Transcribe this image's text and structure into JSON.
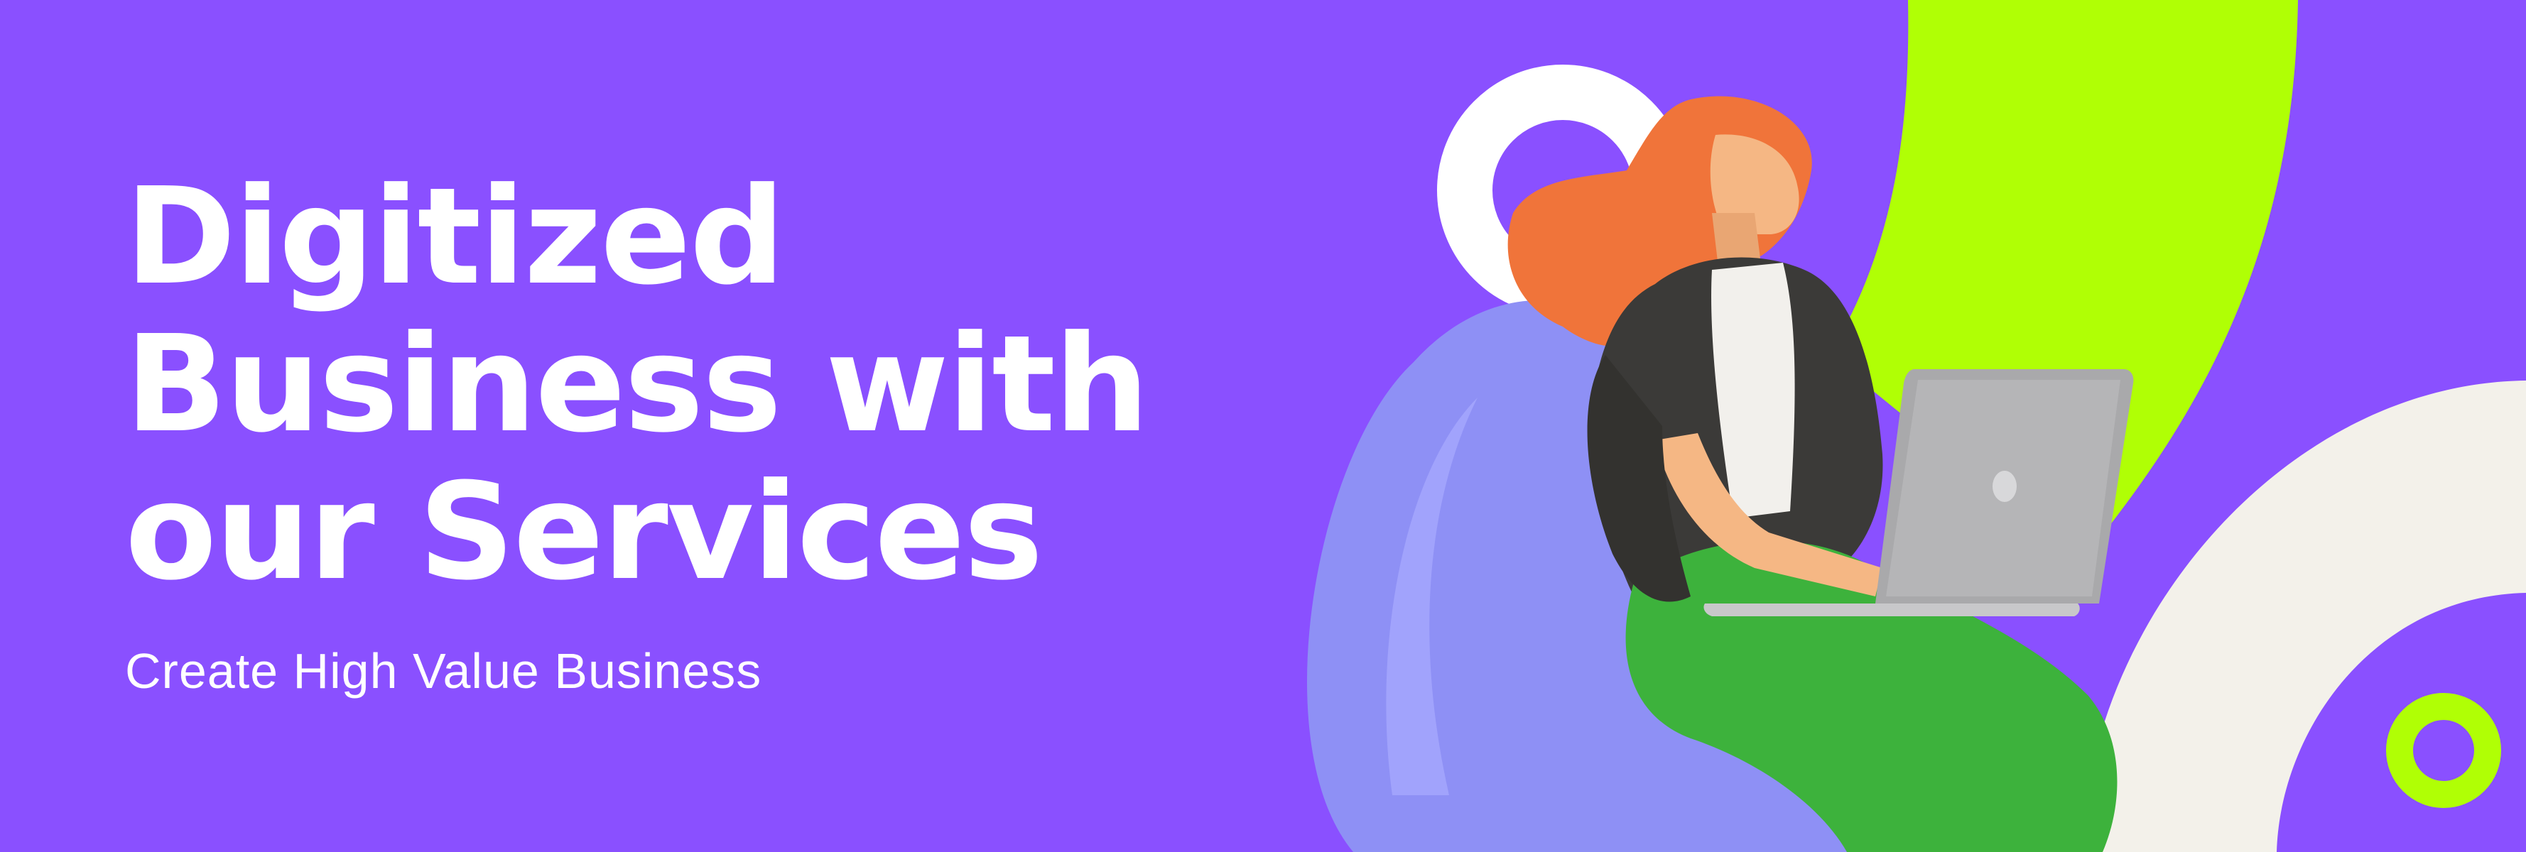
{
  "banner": {
    "headline": {
      "line1": "Digitized",
      "line2": "Business with",
      "line3": "our Services"
    },
    "subtitle": "Create High Value Business"
  },
  "colors": {
    "background": "#8a50ff",
    "lime_accent": "#b0ff05",
    "cream_shape": "#f3f1ea",
    "white": "#ffffff",
    "beanbag": "#8e90f5",
    "hair": "#f0743a",
    "jacket": "#3b3a38",
    "shirt": "#f2f0ec",
    "pants": "#3db23c",
    "skin": "#f5b784",
    "laptop": "#a9a9ab"
  },
  "illustration": {
    "subject": "woman-with-laptop-on-beanbag"
  }
}
